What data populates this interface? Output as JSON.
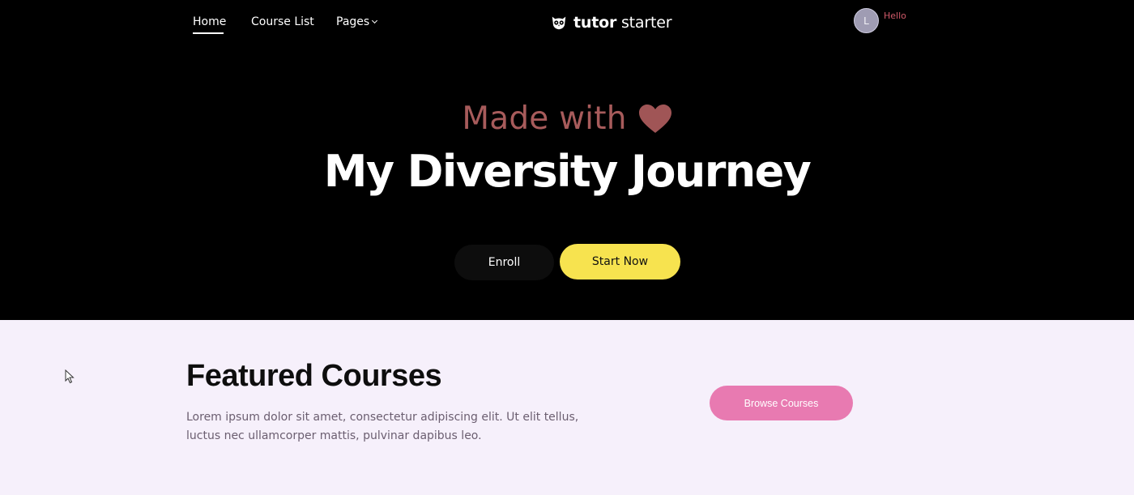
{
  "nav": {
    "home": "Home",
    "course_list": "Course List",
    "pages": "Pages"
  },
  "brand": {
    "name_bold": "tutor",
    "name_light": "starter",
    "icon": "owl-logo-icon"
  },
  "user": {
    "avatar_initial": "L",
    "greeting": "Hello"
  },
  "hero": {
    "made_with": "Made with",
    "heart_icon": "heart-icon",
    "heart_color": "#a05556",
    "title": "My Diversity Journey",
    "enroll_label": "Enroll",
    "start_label": "Start Now"
  },
  "featured": {
    "title": "Featured Courses",
    "description": "Lorem ipsum dolor sit amet, consectetur adipiscing elit. Ut elit tellus, luctus nec ullamcorper mattis, pulvinar dapibus leo.",
    "browse_label": "Browse Courses"
  },
  "colors": {
    "hero_bg": "#000000",
    "section_bg": "#f6f0fb",
    "accent_yellow": "#f7e34f",
    "accent_pink": "#e87ab1"
  }
}
